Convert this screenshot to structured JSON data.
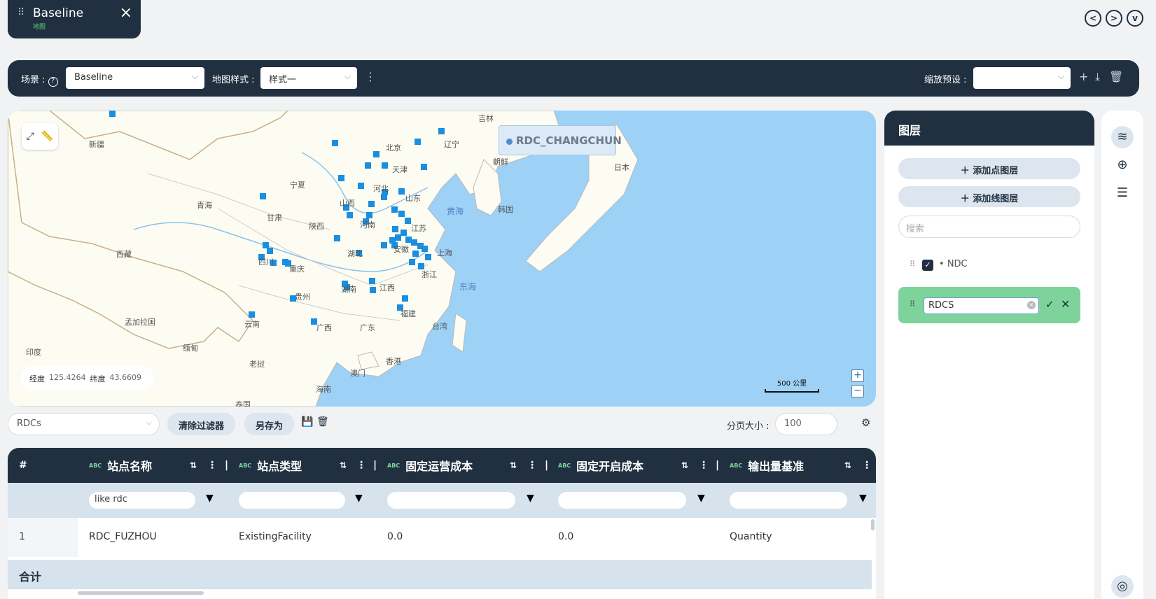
{
  "tab": {
    "title": "Baseline",
    "subtitle": "地图"
  },
  "nav": {
    "prev": "<",
    "next": ">",
    "more": "v"
  },
  "toolbar": {
    "scene_label": "场景 :",
    "scene_value": "Baseline",
    "map_style_label": "地图样式 :",
    "map_style_value": "样式一",
    "zoom_preset_label": "缩放预设 :",
    "zoom_preset_value": ""
  },
  "map": {
    "tooltip": "RDC_CHANGCHUN",
    "coord": {
      "lon_label": "经度",
      "lon_value": "125.4264",
      "lat_label": "纬度",
      "lat_value": "43.6609"
    },
    "scale": "500 公里",
    "labels": [
      "新疆",
      "青海",
      "西藏",
      "甘肃",
      "宁夏",
      "四川",
      "陕西",
      "山西",
      "河北",
      "北京",
      "天津",
      "山东",
      "河南",
      "湖北",
      "安徽",
      "江苏",
      "上海",
      "浙江",
      "江西",
      "湖南",
      "重庆",
      "贵州",
      "云南",
      "广西",
      "广东",
      "福建",
      "台湾",
      "香港",
      "澳门",
      "海南",
      "辽宁",
      "吉林",
      "朝鲜",
      "韩国",
      "日本",
      "黄海",
      "东海",
      "孟加拉国",
      "缅甸",
      "老挝",
      "印度",
      "泰国"
    ]
  },
  "filter": {
    "view_select": "RDCs",
    "clear_label": "清除过滤器",
    "save_as_label": "另存为",
    "page_size_label": "分页大小 :",
    "page_size_value": "100"
  },
  "table": {
    "index_header": "#",
    "type_badge": "ABC",
    "columns": [
      "站点名称",
      "站点类型",
      "固定运营成本",
      "固定开启成本",
      "输出量基准"
    ],
    "filters": [
      "like rdc",
      "",
      "",
      "",
      ""
    ],
    "rows": [
      {
        "index": "1",
        "cells": [
          "RDC_FUZHOU",
          "ExistingFacility",
          "0.0",
          "0.0",
          "Quantity"
        ]
      }
    ],
    "total_label": "合计"
  },
  "layers": {
    "title": "图层",
    "add_point": "添加点图层",
    "add_line": "添加线图层",
    "search_placeholder": "搜索",
    "items": [
      {
        "name": "NDC",
        "checked": true
      }
    ],
    "editing_value": "RDCS"
  },
  "colors": {
    "dark": "#203040",
    "accent_green": "#7ed39b",
    "marker_blue": "#1a8ee0",
    "sea": "#9dd1f5"
  }
}
